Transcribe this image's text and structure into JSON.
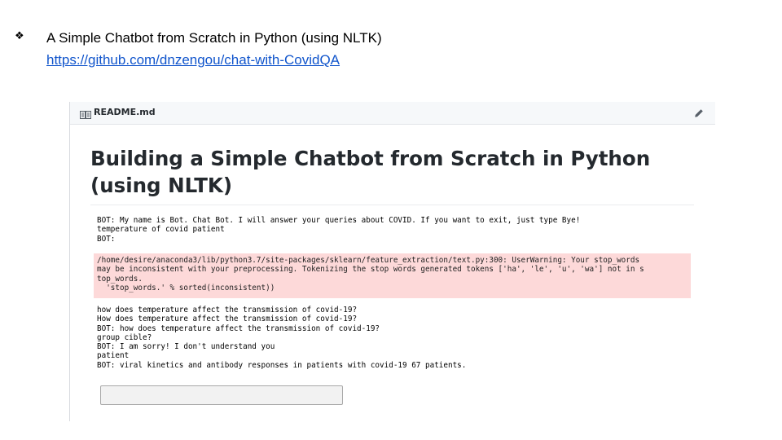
{
  "slide": {
    "bullet_symbol": "❖",
    "bullet_text": "A Simple Chatbot from Scratch in Python (using NLTK)",
    "link_text": "https://github.com/dnzengou/chat-with-CovidQA",
    "link_color": "#1155cc"
  },
  "readme": {
    "header_title": "README.md",
    "icons": [
      "book-icon",
      "pencil-icon"
    ],
    "title": "Building a Simple Chatbot from Scratch in Python (using NLTK)",
    "terminal": {
      "lines_top": [
        "BOT: My name is Bot. Chat Bot. I will answer your queries about COVID. If you want to exit, just type Bye!",
        "temperature of covid patient",
        "BOT:"
      ],
      "warning_lines": [
        "/home/desire/anaconda3/lib/python3.7/site-packages/sklearn/feature_extraction/text.py:300: UserWarning: Your stop_words",
        "may be inconsistent with your preprocessing. Tokenizing the stop words generated tokens ['ha', 'le', 'u', 'wa'] not in s",
        "top_words.",
        "  'stop_words.' % sorted(inconsistent))"
      ],
      "lines_bottom": [
        "how does temperature affect the transmission of covid-19?",
        "How does temperature affect the transmission of covid-19?",
        "BOT: how does temperature affect the transmission of covid-19?",
        "group cible?",
        "BOT: I am sorry! I don't understand you",
        "patient",
        "BOT: viral kinetics and antibody responses in patients with covid-19 67 patients."
      ],
      "warning_background": "#fdd9d9"
    },
    "input": {
      "value": ""
    }
  }
}
